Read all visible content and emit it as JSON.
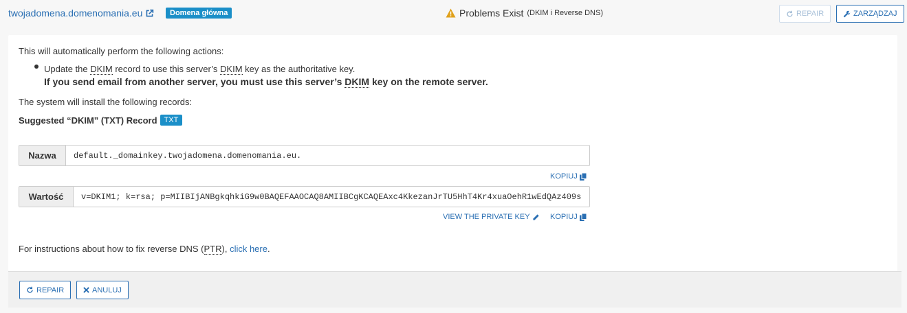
{
  "header": {
    "domain": "twojadomena.domenomania.eu",
    "main_badge": "Domena główna",
    "status_title": "Problems Exist",
    "status_detail": "(DKIM i Reverse DNS)",
    "repair_label": "REPAIR",
    "manage_label": "ZARZĄDZAJ"
  },
  "panel": {
    "intro": "This will automatically perform the following actions:",
    "bullet_line1_pre": "Update the ",
    "bullet_line1_dkim1": "DKIM",
    "bullet_line1_mid": " record to use this server’s ",
    "bullet_line1_dkim2": "DKIM",
    "bullet_line1_post": " key as the authoritative key.",
    "bullet_line2_pre": "If you send email from another server, you must use this server’s ",
    "bullet_line2_dkim": "DKIM",
    "bullet_line2_post": " key on the remote server.",
    "install_text": "The system will install the following records:",
    "suggested_label": "Suggested “DKIM” (TXT) Record",
    "record_type_badge": "TXT",
    "name_label": "Nazwa",
    "name_value": "default._domainkey.twojadomena.domenomania.eu.",
    "copy_label": "KOPIUJ",
    "value_label": "Wartość",
    "value_value": "v=DKIM1; k=rsa; p=MIIBIjANBgkqhkiG9w0BAQEFAAOCAQ8AMIIBCgKCAQEAxc4KkezanJrTU5HhT4Kr4xuaOehR1wEdQAz409s",
    "view_private_key": "VIEW THE PRIVATE KEY",
    "ptr_pre": "For instructions about how to fix reverse DNS (",
    "ptr_abbr": "PTR",
    "ptr_mid": "), ",
    "ptr_link": "click here",
    "ptr_post": "."
  },
  "footer": {
    "repair_label": "REPAIR",
    "cancel_label": "ANULUJ"
  },
  "colors": {
    "link": "#2a6fb3",
    "badge": "#1b8fc8",
    "warning": "#e0a11b"
  },
  "icons": {
    "external_link": "external-link-icon",
    "warning": "warning-icon",
    "refresh": "refresh-icon",
    "wrench": "wrench-icon",
    "copy": "copy-icon",
    "pencil": "pencil-icon",
    "close": "close-icon"
  }
}
